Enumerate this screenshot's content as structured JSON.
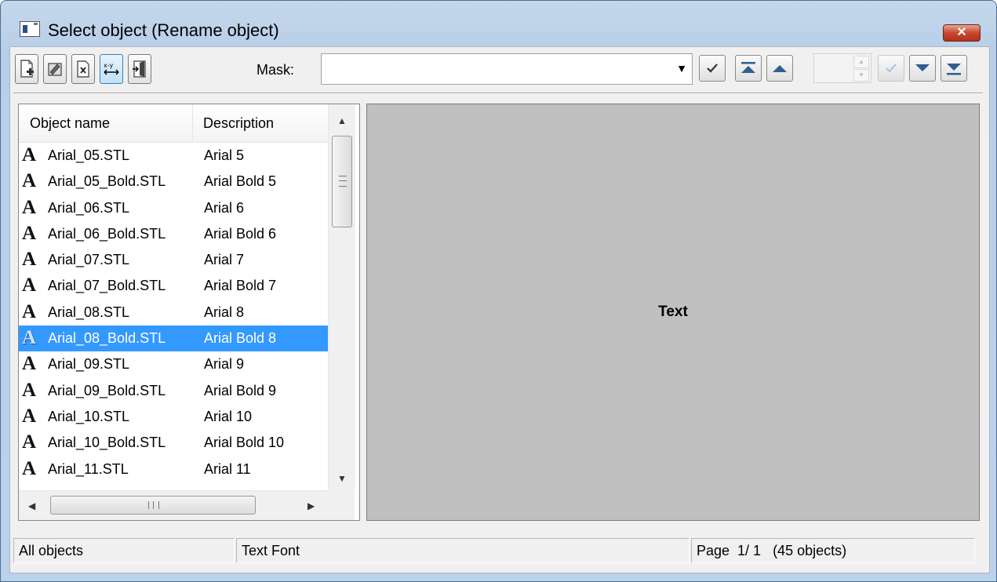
{
  "window": {
    "title": "Select object (Rename object)",
    "close_symbol": "✕"
  },
  "toolbar": {
    "buttons": [
      {
        "name": "new-object-icon"
      },
      {
        "name": "edit-object-icon"
      },
      {
        "name": "delete-object-icon"
      },
      {
        "name": "rename-object-icon",
        "active": true
      },
      {
        "name": "exit-icon"
      }
    ],
    "mask_label": "Mask:",
    "mask_value": "",
    "nav_buttons": [
      "apply-mask-icon",
      "first-page-icon",
      "previous-page-icon",
      "confirm-page-icon",
      "next-page-icon",
      "last-page-icon"
    ]
  },
  "list": {
    "columns": [
      "Object name",
      "Description"
    ],
    "rows": [
      {
        "name": "Arial_05.STL",
        "desc": "Arial 5"
      },
      {
        "name": "Arial_05_Bold.STL",
        "desc": "Arial Bold 5"
      },
      {
        "name": "Arial_06.STL",
        "desc": "Arial 6"
      },
      {
        "name": "Arial_06_Bold.STL",
        "desc": "Arial Bold 6"
      },
      {
        "name": "Arial_07.STL",
        "desc": "Arial 7"
      },
      {
        "name": "Arial_07_Bold.STL",
        "desc": "Arial Bold 7"
      },
      {
        "name": "Arial_08.STL",
        "desc": "Arial 8"
      },
      {
        "name": "Arial_08_Bold.STL",
        "desc": "Arial Bold 8",
        "selected": true
      },
      {
        "name": "Arial_09.STL",
        "desc": "Arial 9"
      },
      {
        "name": "Arial_09_Bold.STL",
        "desc": "Arial Bold 9"
      },
      {
        "name": "Arial_10.STL",
        "desc": "Arial 10"
      },
      {
        "name": "Arial_10_Bold.STL",
        "desc": "Arial Bold 10"
      },
      {
        "name": "Arial_11.STL",
        "desc": "Arial 11"
      }
    ],
    "row_icon_glyph": "A",
    "hscroll_grip": "III"
  },
  "preview": {
    "text": "Text"
  },
  "status": {
    "filter": "All objects",
    "type": "Text Font",
    "page": "Page  1/ 1   (45 objects)"
  },
  "colors": {
    "selection": "#3399ff",
    "preview_bg": "#c0c0c0",
    "title_gradient": "#c5d7ec"
  }
}
